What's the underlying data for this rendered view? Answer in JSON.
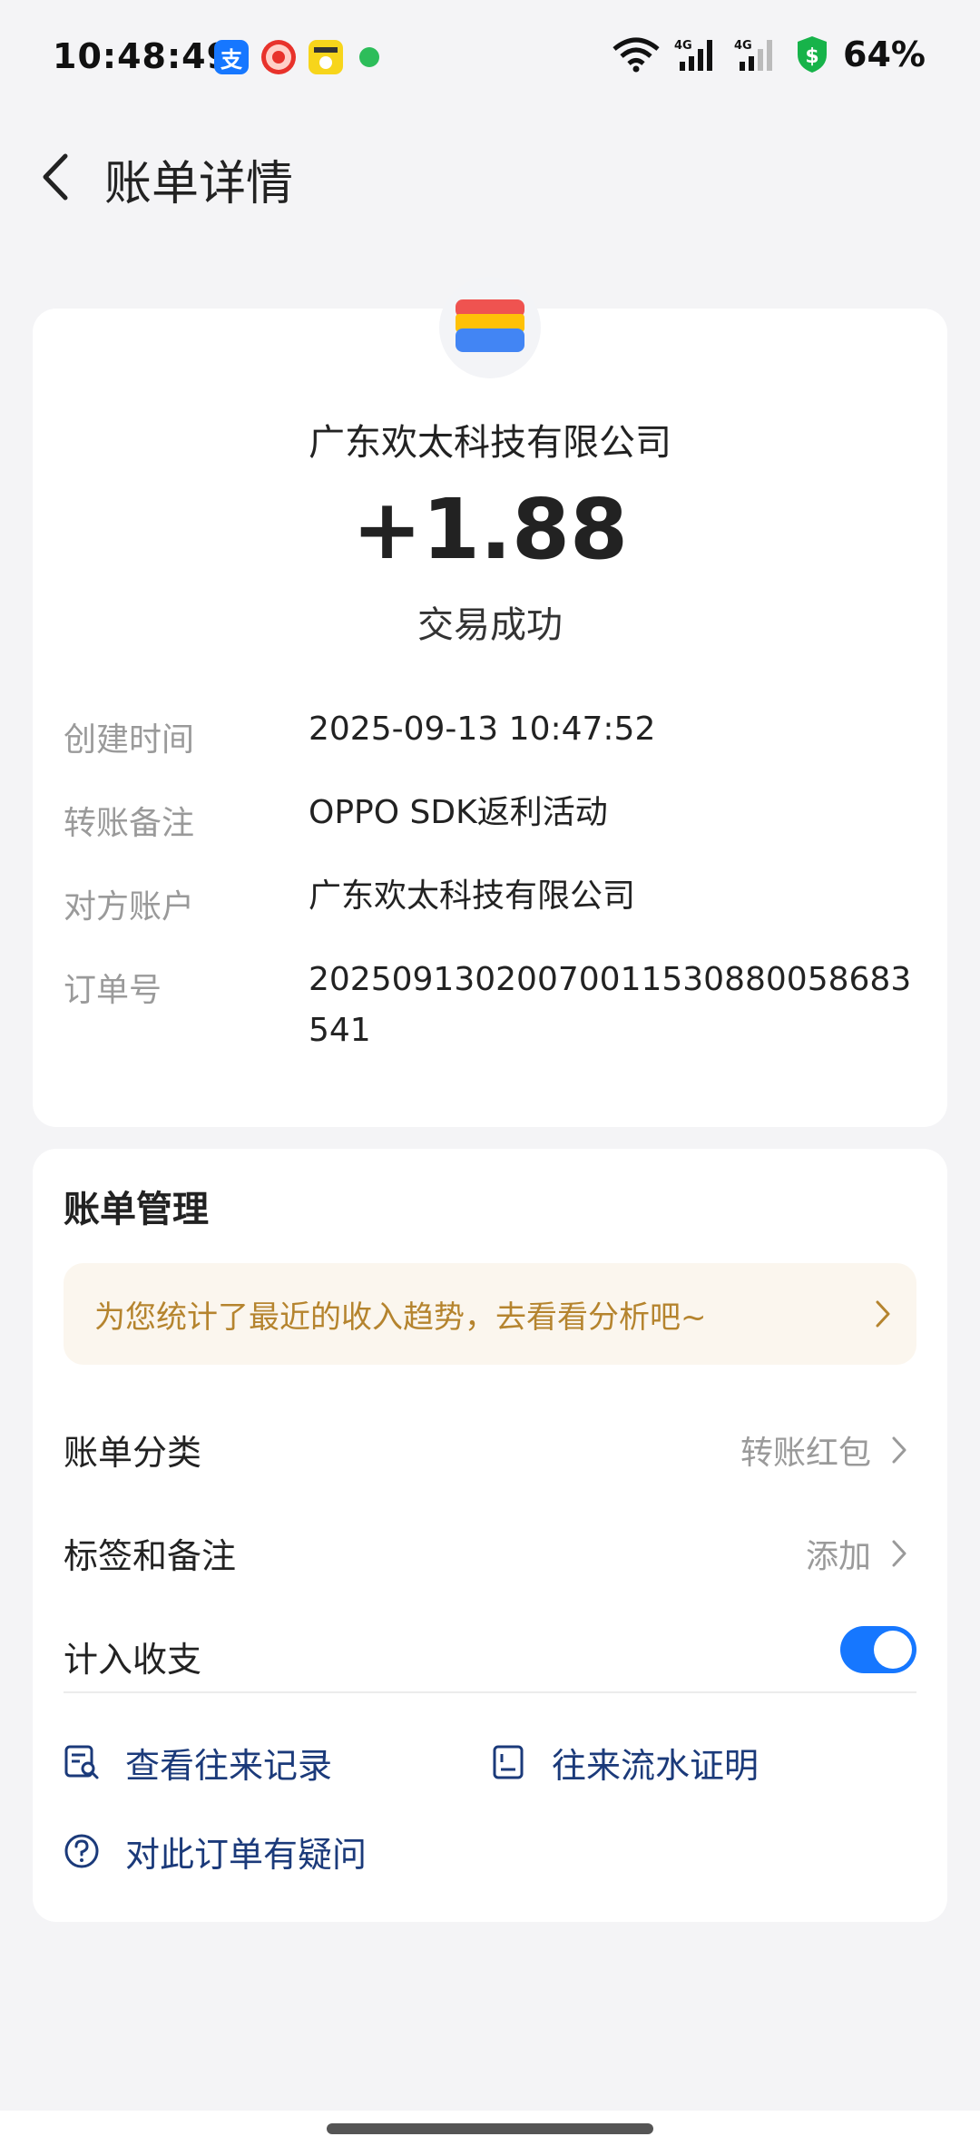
{
  "status_bar": {
    "time": "10:48:49",
    "battery": "64%",
    "app_icons": [
      "alipay-icon",
      "red-envelope-app-icon",
      "yellow-app-icon",
      "green-dot-icon"
    ],
    "app_alipay_glyph": "支",
    "network": [
      "wifi-icon",
      "signal-4g-icon",
      "signal-4g-icon",
      "shield-money-icon"
    ]
  },
  "nav": {
    "title": "账单详情",
    "back_icon": "chevron-left-icon"
  },
  "summary": {
    "payee": "广东欢太科技有限公司",
    "amount": "+1.88",
    "status": "交易成功",
    "logo_icon": "wallet-logo-icon"
  },
  "details": [
    {
      "label": "创建时间",
      "value": "2025-09-13 10:47:52"
    },
    {
      "label": "转账备注",
      "value": "OPPO SDK返利活动"
    },
    {
      "label": "对方账户",
      "value": "广东欢太科技有限公司"
    },
    {
      "label": "订单号",
      "value": "20250913020070011530880058683541"
    }
  ],
  "management": {
    "title": "账单管理",
    "banner_text": "为您统计了最近的收入趋势，去看看分析吧~",
    "category_label": "账单分类",
    "category_value": "转账红包",
    "tags_label": "标签和备注",
    "tags_value": "添加",
    "include_label": "计入收支",
    "include_on": true,
    "links": {
      "records": "查看往来记录",
      "statement": "往来流水证明",
      "question": "对此订单有疑问"
    }
  },
  "colors": {
    "accent": "#1677ff",
    "link": "#1b3a7a",
    "banner_text": "#b5842e",
    "banner_bg": "#fbf6ee"
  }
}
